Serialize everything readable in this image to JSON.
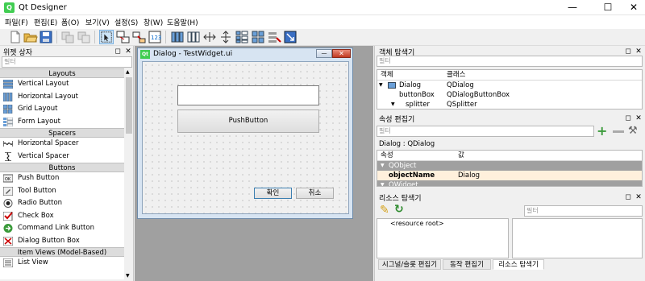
{
  "app": {
    "title": "Qt Designer",
    "icon_text": "Q"
  },
  "menus": [
    "파일(F)",
    "편집(E)",
    "폼(O)",
    "보기(V)",
    "설정(S)",
    "창(W)",
    "도움말(H)"
  ],
  "widget_box": {
    "title": "위젯 상자",
    "filter": "필터",
    "categories": [
      {
        "name": "Layouts",
        "items": [
          "Vertical Layout",
          "Horizontal Layout",
          "Grid Layout",
          "Form Layout"
        ]
      },
      {
        "name": "Spacers",
        "items": [
          "Horizontal Spacer",
          "Vertical Spacer"
        ]
      },
      {
        "name": "Buttons",
        "items": [
          "Push Button",
          "Tool Button",
          "Radio Button",
          "Check Box",
          "Command Link Button",
          "Dialog Button Box"
        ]
      },
      {
        "name": "Item Views (Model-Based)",
        "items": [
          "List View"
        ]
      }
    ]
  },
  "form": {
    "title": "Dialog - TestWidget.ui",
    "qt_icon": "Qt",
    "push_button": "PushButton",
    "ok": "확인",
    "cancel": "취소"
  },
  "object_inspector": {
    "title": "객체 탐색기",
    "filter": "필터",
    "col_object": "객체",
    "col_class": "클래스",
    "rows": [
      {
        "object": "Dialog",
        "class": "QDialog"
      },
      {
        "object": "buttonBox",
        "class": "QDialogButtonBox"
      },
      {
        "object": "splitter",
        "class": "QSplitter"
      }
    ]
  },
  "property_editor": {
    "title": "속성 편집기",
    "filter": "필터",
    "context": "Dialog : QDialog",
    "col_prop": "속성",
    "col_value": "값",
    "group1": "QObject",
    "prop_name": "objectName",
    "prop_value": "Dialog",
    "group2": "QWidget"
  },
  "resource_browser": {
    "title": "리소스 탐색기",
    "filter": "필터",
    "root": "<resource root>"
  },
  "tabs": [
    "시그널/슬롯 편집기",
    "동작 편집기",
    "리소스 탐색기"
  ],
  "colors": {
    "group_header": "#a0a0a0",
    "selected": "#cde8ff",
    "prop_row": "#fff0dc"
  }
}
